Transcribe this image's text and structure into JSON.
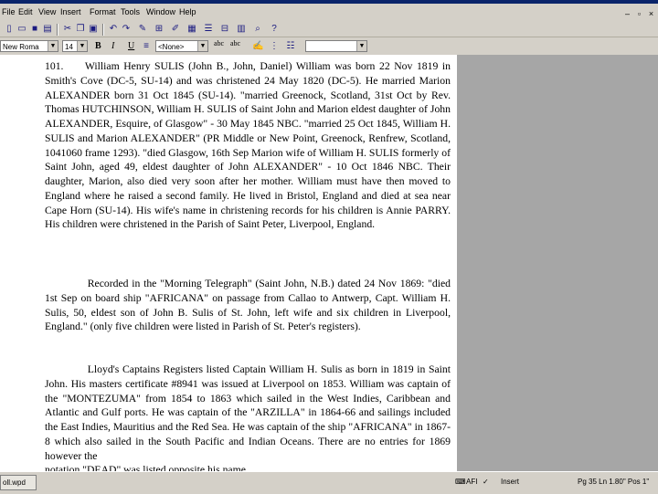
{
  "menu": [
    "File",
    "Edit",
    "View",
    "Insert",
    "Format",
    "Tools",
    "Window",
    "Help"
  ],
  "toolbar": {
    "font_name": "New Roma",
    "font_size": "14",
    "style": "<None>",
    "bold": "B",
    "italic": "I",
    "underline": "U",
    "sub_a": "abc",
    "sub_b": "abc",
    "icons": [
      "new-icon",
      "open-icon",
      "save-icon",
      "print-icon",
      "cut-icon",
      "copy-icon",
      "paste-icon",
      "undo-icon",
      "redo-icon",
      "brush-icon",
      "insert-icon",
      "list-icon",
      "table-icon",
      "columns-icon",
      "zoom-icon"
    ]
  },
  "document": {
    "paragraphs": [
      "101.  William Henry SULIS (John B., John, Daniel) William was born 22 Nov 1819 in Smith's Cove (DC-5, SU-14) and was christened 24 May 1820 (DC-5). He married Marion ALEXANDER born 31 Oct 1845 (SU-14). \"married Greenock, Scotland, 31st Oct by Rev. Thomas HUTCHINSON, William H. SULIS of Saint John and Marion eldest daughter of John ALEXANDER, Esquire, of Glasgow\" - 30 May 1845 NBC. \"married 25 Oct 1845, William H. SULIS and Marion ALEXANDER\" (PR Middle or New Point, Greenock, Renfrew, Scotland, 1041060 frame 1293). \"died Glasgow, 16th Sep Marion wife of William H. SULIS formerly of Saint John, aged 49, eldest daughter of John ALEXANDER\" - 10 Oct 1846 NBC. Their daughter, Marion, also died very soon after her mother. William must have then moved to England where he raised a second family. He lived in Bristol, England and died at sea near Cape Horn (SU-14). His wife's name in christening records for his children is Annie PARRY. His children were christened in the Parish of Saint Peter, Liverpool, England.",
      "    Recorded in the \"Morning Telegraph\" (Saint John, N.B.) dated 24 Nov 1869: \"died 1st Sep on board ship \"AFRICANA\" on passage from Callao to Antwerp, Capt. William H. Sulis, 50, eldest son of John B. Sulis of St. John, left wife and six children in Liverpool, England.\" (only five children were listed in Parish of St. Peter's registers).",
      "    Lloyd's Captains Registers listed Captain William H. Sulis as born in 1819 in Saint John. His masters certificate #8941 was issued at Liverpool on 1853. William was captain of the \"MONTEZUMA\" from 1854 to 1863 which sailed in the West Indies, Caribbean and Atlantic and Gulf ports. He was captain of the \"ARZILLA\" in 1864-66 and sailings included the East Indies, Mauritius and the Red Sea. He was captain of the ship \"AFRICANA\" in 1867-8 which also sailed in the South Pacific and Indian Oceans. There are no entries for 1869 however the"
    ],
    "last_line_partial": "notation \"DEAD\" was listed opposite his name."
  },
  "status": {
    "file_name": "oll.wpd",
    "lang": "AFI",
    "mode": "Insert",
    "position": "Pg 35 Ln 1.80\" Pos 1\""
  }
}
